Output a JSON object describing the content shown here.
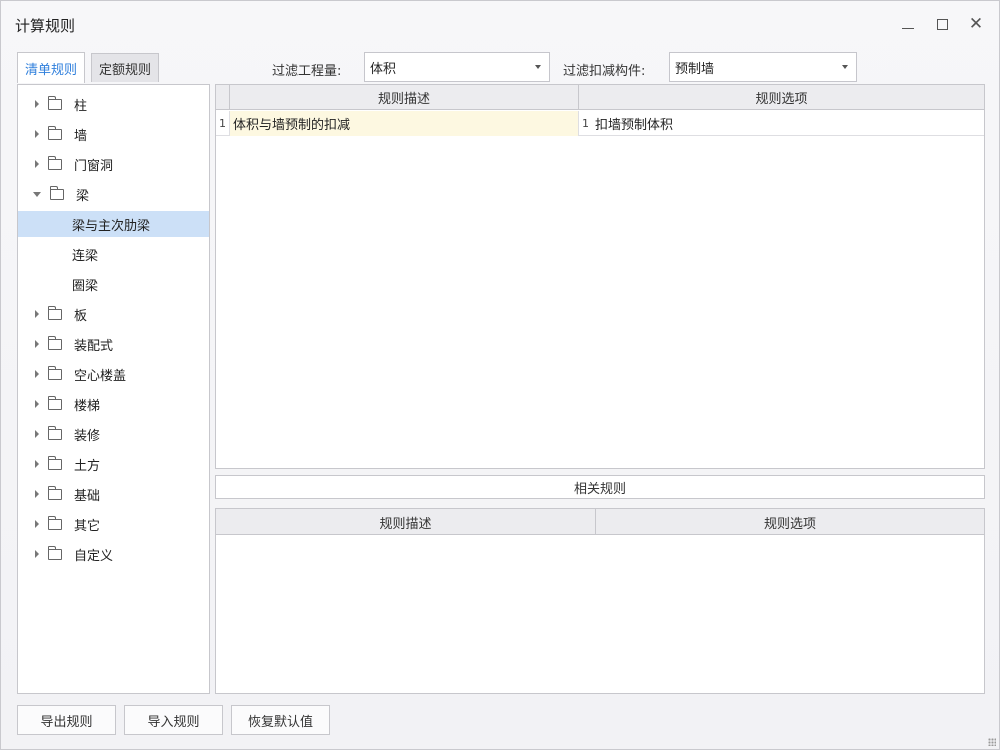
{
  "window": {
    "title": "计算规则"
  },
  "tabs": [
    {
      "label": "清单规则",
      "active": true
    },
    {
      "label": "定额规则",
      "active": false
    }
  ],
  "filters": {
    "quantity_label": "过滤工程量:",
    "quantity_value": "体积",
    "component_label": "过滤扣减构件:",
    "component_value": "预制墙"
  },
  "tree": {
    "items": [
      {
        "label": "柱",
        "expanded": false
      },
      {
        "label": "墙",
        "expanded": false
      },
      {
        "label": "门窗洞",
        "expanded": false
      },
      {
        "label": "梁",
        "expanded": true
      },
      {
        "label": "梁与主次肋梁",
        "child": true,
        "selected": true
      },
      {
        "label": "连梁",
        "child": true
      },
      {
        "label": "圈梁",
        "child": true
      },
      {
        "label": "板",
        "expanded": false
      },
      {
        "label": "装配式",
        "expanded": false
      },
      {
        "label": "空心楼盖",
        "expanded": false
      },
      {
        "label": "楼梯",
        "expanded": false
      },
      {
        "label": "装修",
        "expanded": false
      },
      {
        "label": "土方",
        "expanded": false
      },
      {
        "label": "基础",
        "expanded": false
      },
      {
        "label": "其它",
        "expanded": false
      },
      {
        "label": "自定义",
        "expanded": false
      }
    ]
  },
  "rules_grid": {
    "col_desc": "规则描述",
    "col_option": "规则选项",
    "rows": [
      {
        "num": "1",
        "desc": "体积与墙预制的扣减",
        "option_idx": "1",
        "option": "扣墙预制体积"
      }
    ]
  },
  "related": {
    "title": "相关规则",
    "col_desc": "规则描述",
    "col_option": "规则选项"
  },
  "buttons": {
    "export": "导出规则",
    "import": "导入规则",
    "restore": "恢复默认值"
  },
  "colors": {
    "accent": "#2f7fdc",
    "selected_bg": "#cce0f7",
    "highlight_cell": "#fdf8e1"
  }
}
